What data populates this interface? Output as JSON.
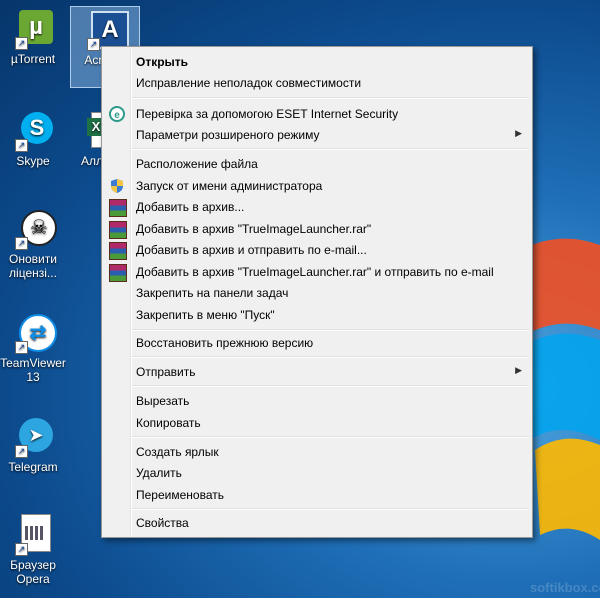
{
  "desktop": {
    "icons": [
      {
        "label": "µTorrent"
      },
      {
        "label": "Acro Im"
      },
      {
        "label": "Skype"
      },
      {
        "label": "Алла те"
      },
      {
        "label": "Оновити ліцензі..."
      },
      {
        "label": "TeamViewer 13"
      },
      {
        "label": "Telegram"
      },
      {
        "label": "Браузер Opera"
      }
    ],
    "watermark": "softikbox.com"
  },
  "menu": {
    "items": [
      {
        "label": "Открыть"
      },
      {
        "label": "Исправление неполадок совместимости"
      },
      {
        "label": "Перевірка за допомогою ESET Internet Security"
      },
      {
        "label": "Параметри розширеного режиму"
      },
      {
        "label": "Расположение файла"
      },
      {
        "label": "Запуск от имени администратора"
      },
      {
        "label": "Добавить в архив..."
      },
      {
        "label": "Добавить в архив \"TrueImageLauncher.rar\""
      },
      {
        "label": "Добавить в архив и отправить по e-mail..."
      },
      {
        "label": "Добавить в архив \"TrueImageLauncher.rar\" и отправить по e-mail"
      },
      {
        "label": "Закрепить на панели задач"
      },
      {
        "label": "Закрепить в меню \"Пуск\""
      },
      {
        "label": "Восстановить прежнюю версию"
      },
      {
        "label": "Отправить"
      },
      {
        "label": "Вырезать"
      },
      {
        "label": "Копировать"
      },
      {
        "label": "Создать ярлык"
      },
      {
        "label": "Удалить"
      },
      {
        "label": "Переименовать"
      },
      {
        "label": "Свойства"
      }
    ]
  }
}
